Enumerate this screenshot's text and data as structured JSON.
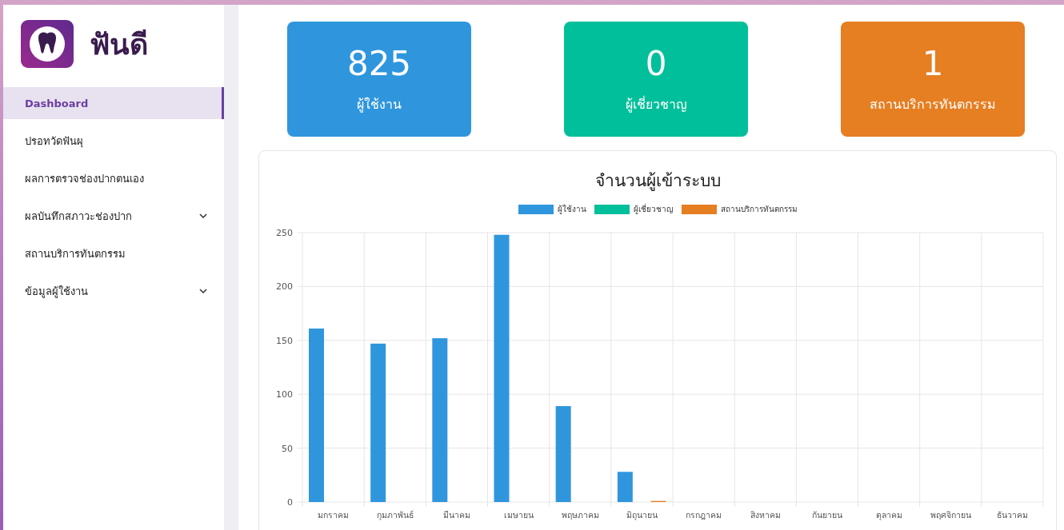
{
  "brand": {
    "name": "ฟันดี"
  },
  "sidebar": {
    "items": [
      {
        "label": "Dashboard",
        "selected": true,
        "expandable": false
      },
      {
        "label": "ปรอทวัดฟันผุ",
        "selected": false,
        "expandable": false
      },
      {
        "label": "ผลการตรวจช่องปากตนเอง",
        "selected": false,
        "expandable": false
      },
      {
        "label": "ผลบันทึกสภาวะช่องปาก",
        "selected": false,
        "expandable": true
      },
      {
        "label": "สถานบริการทันตกรรม",
        "selected": false,
        "expandable": false
      },
      {
        "label": "ข้อมูลผู้ใช้งาน",
        "selected": false,
        "expandable": true
      }
    ]
  },
  "stats": [
    {
      "value": "825",
      "label": "ผู้ใช้งาน",
      "color": "#2f96dd"
    },
    {
      "value": "0",
      "label": "ผู้เชี่ยวชาญ",
      "color": "#00bf9a"
    },
    {
      "value": "1",
      "label": "สถานบริการทันตกรรม",
      "color": "#e67e22"
    }
  ],
  "chart": {
    "chart_data": {
      "type": "bar",
      "title": "จำนวนผู้เข้าระบบ",
      "categories": [
        "มกราคม",
        "กุมภาพันธ์",
        "มีนาคม",
        "เมษายน",
        "พฤษภาคม",
        "มิถุนายน",
        "กรกฎาคม",
        "สิงหาคม",
        "กันยายน",
        "ตุลาคม",
        "พฤศจิกายน",
        "ธันวาคม"
      ],
      "series": [
        {
          "name": "ผู้ใช้งาน",
          "color": "#2f96dd",
          "values": [
            161,
            147,
            152,
            248,
            89,
            28,
            0,
            0,
            0,
            0,
            0,
            0
          ]
        },
        {
          "name": "ผู้เชี่ยวชาญ",
          "color": "#00bf9a",
          "values": [
            0,
            0,
            0,
            0,
            0,
            0,
            0,
            0,
            0,
            0,
            0,
            0
          ]
        },
        {
          "name": "สถานบริการทันตกรรม",
          "color": "#e67e22",
          "values": [
            0,
            0,
            0,
            0,
            0,
            1,
            0,
            0,
            0,
            0,
            0,
            0
          ]
        }
      ],
      "grid": true,
      "ylim": [
        0,
        250
      ],
      "yticks": [
        0,
        50,
        100,
        150,
        200,
        250
      ]
    }
  }
}
